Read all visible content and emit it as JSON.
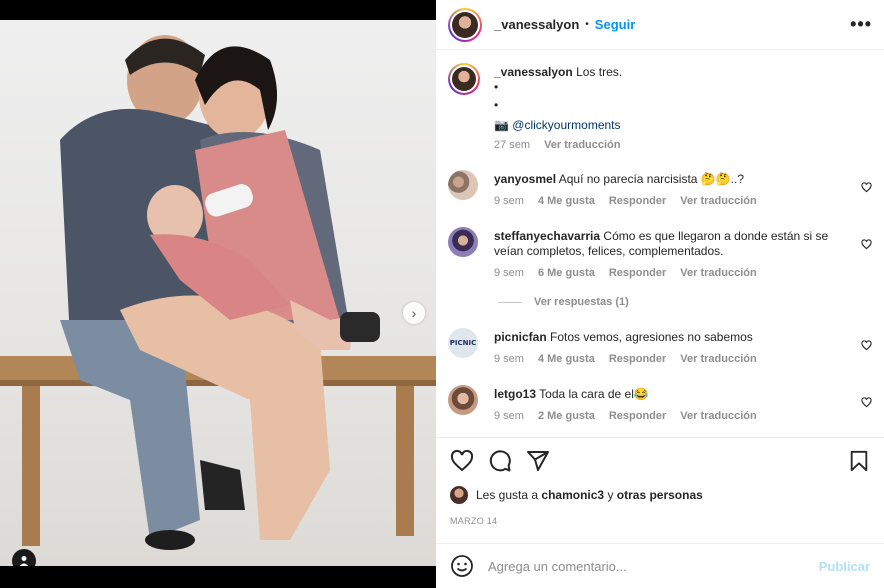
{
  "post": {
    "author": "_vanessalyon",
    "follow_label": "Seguir",
    "caption_text": "Los tres.",
    "caption_bullet_1": "•",
    "caption_bullet_2": "•",
    "camera_emoji": "📷",
    "caption_mention": "@clickyourmoments",
    "caption_time": "27 sem",
    "translate_label": "Ver traducción",
    "dot_separator": "•",
    "more_glyph": "•••"
  },
  "comments": [
    {
      "user": "yanyosmel",
      "text": "Aquí no parecía narcisista 🤔🤔..?",
      "time": "9 sem",
      "likes": "4 Me gusta",
      "reply": "Responder",
      "translate": "Ver traducción"
    },
    {
      "user": "steffanyechavarria",
      "text": "Cómo es que llegaron a donde están si se veían completos, felices, complementados.",
      "time": "9 sem",
      "likes": "6 Me gusta",
      "reply": "Responder",
      "translate": "Ver traducción",
      "replies_label": "Ver respuestas (1)"
    },
    {
      "user": "picnicfan",
      "text": "Fotos vemos, agresiones no sabemos",
      "time": "9 sem",
      "likes": "4 Me gusta",
      "reply": "Responder",
      "translate": "Ver traducción",
      "avatar_text": "PICNIC"
    },
    {
      "user": "letgo13",
      "text": "Toda la cara de el😂",
      "time": "9 sem",
      "likes": "2 Me gusta",
      "reply": "Responder",
      "translate": "Ver traducción"
    }
  ],
  "likes": {
    "prefix": "Les gusta a",
    "user": "chamonic3",
    "middle": "y",
    "suffix": "otras personas"
  },
  "date": "MARZO 14",
  "composer": {
    "placeholder": "Agrega un comentario...",
    "publish_label": "Publicar"
  },
  "carousel": {
    "total_slides": 4,
    "active_slide": 1
  },
  "icons": [
    "heart-icon",
    "comment-icon",
    "share-icon",
    "bookmark-icon",
    "emoji-icon",
    "tag-user-icon",
    "chevron-right-icon"
  ],
  "colors": {
    "accent": "#0095f6",
    "text": "#262626",
    "muted": "#8e8e8e",
    "publish_disabled": "#b2dffc"
  }
}
